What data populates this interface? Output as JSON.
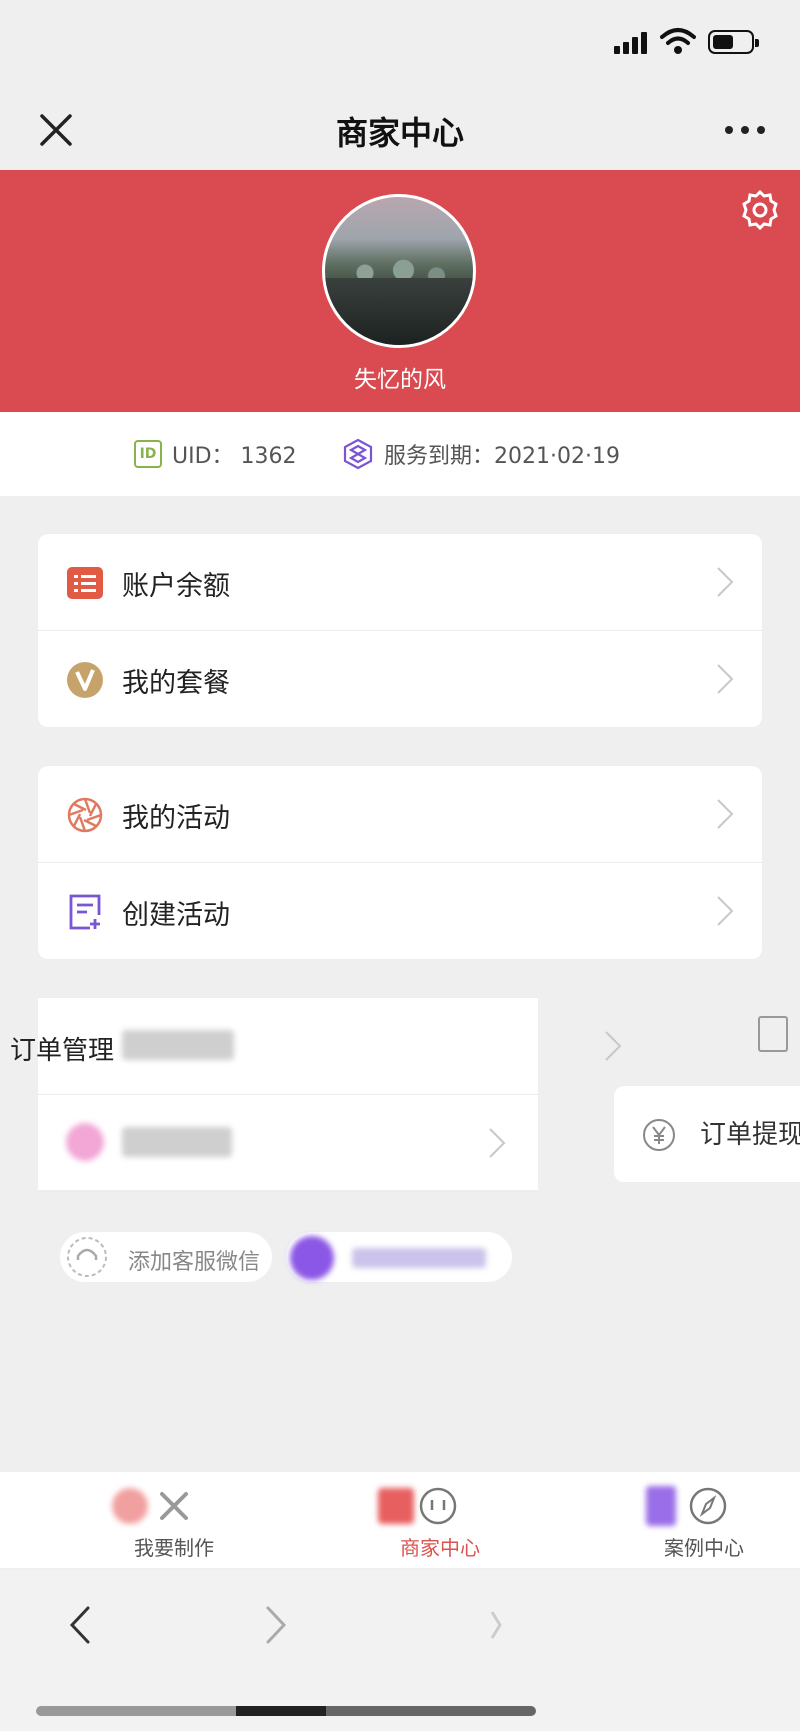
{
  "nav": {
    "title": "商家中心"
  },
  "header": {
    "username": "失忆的风"
  },
  "info": {
    "id_badge": "ID",
    "uid_label": "UID：",
    "uid_value": "1362",
    "expire_label": "服务到期：",
    "expire_value": "2021·02·19"
  },
  "account_card": [
    {
      "label": "账户余额"
    },
    {
      "label": "我的套餐"
    }
  ],
  "activity_card": [
    {
      "label": "我的活动"
    },
    {
      "label": "创建活动"
    }
  ],
  "orders": {
    "manage_label": "订单管理",
    "withdraw_label": "订单提现"
  },
  "service": {
    "add_wechat_label": "添加客服微信"
  },
  "tabs": [
    {
      "label": "我要制作"
    },
    {
      "label": "商家中心"
    },
    {
      "label": "案例中心"
    }
  ],
  "colors": {
    "header_bg": "#da4a51",
    "id_badge": "#89b34a",
    "accent_purple": "#7a55d3"
  }
}
